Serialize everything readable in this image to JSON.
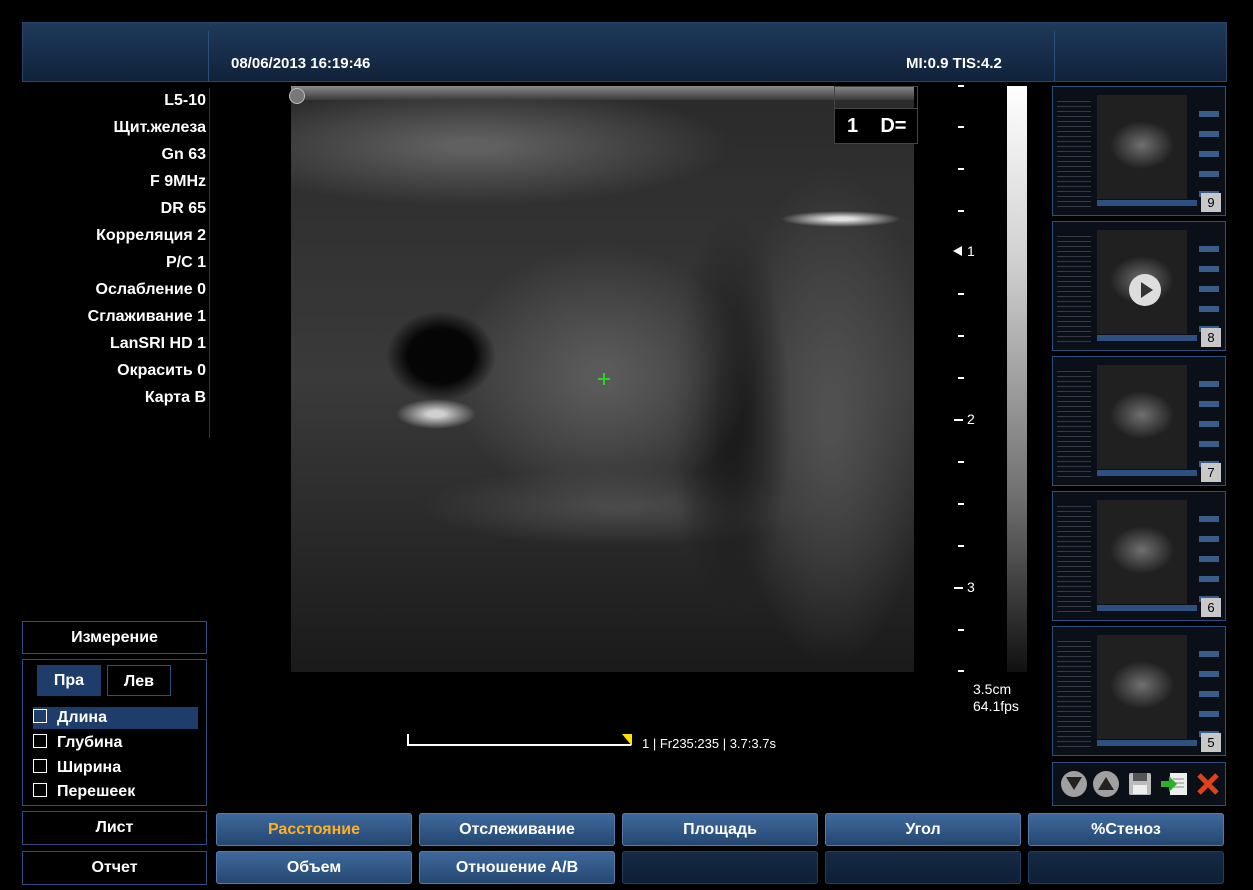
{
  "header": {
    "datetime": "08/06/2013 16:19:46",
    "mi_tis": "MI:0.9 TIS:4.2"
  },
  "params": [
    "L5-10",
    "Щит.железа",
    "Gn 63",
    "F 9MHz",
    "DR 65",
    "Корреляция 2",
    "P/C 1",
    "Ослабление 0",
    "Сглаживание 1",
    "LanSRI HD 1",
    "Окрасить 0",
    "Карта B"
  ],
  "measure_box": {
    "index": "1",
    "label": "D="
  },
  "depth": {
    "labels": [
      "1",
      "2",
      "3"
    ],
    "range": "3.5cm",
    "fps": "64.1fps"
  },
  "cine": {
    "info": "1 | Fr235:235 | 3.7:3.7s"
  },
  "thumbnails": [
    "9",
    "8",
    "7",
    "6",
    "5"
  ],
  "toolbar_icons": [
    "arrow-down-icon",
    "arrow-up-icon",
    "save-icon",
    "export-icon",
    "delete-icon"
  ],
  "measurement_panel": {
    "title": "Измерение",
    "tabs": [
      "Пра",
      "Лев"
    ],
    "items": [
      "Длина",
      "Глубина",
      "Ширина",
      "Перешеек"
    ],
    "selected_item": "Длина"
  },
  "left_buttons": {
    "sheet": "Лист",
    "report": "Отчет"
  },
  "buttons_row1": [
    "Расстояние",
    "Отслеживание",
    "Площадь",
    "Угол",
    "%Стеноз"
  ],
  "buttons_row2": [
    "Объем",
    "Отношение A/B",
    "",
    "",
    ""
  ],
  "colors": {
    "accent": "#ffb020",
    "panel_border": "#2d5080",
    "button": "#3f6a9e",
    "crosshair": "#2bd22b",
    "cine_marker": "#ffe000"
  }
}
